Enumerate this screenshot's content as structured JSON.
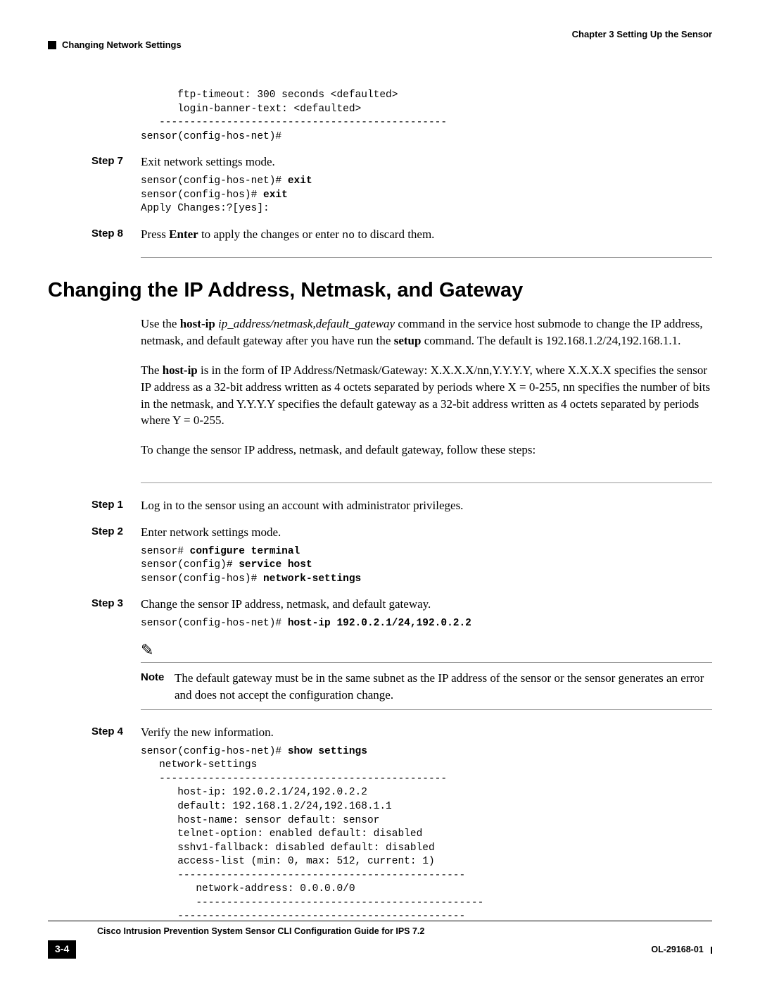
{
  "header": {
    "chapter": "Chapter 3      Setting Up the Sensor",
    "section": "Changing Network Settings"
  },
  "pre_code_top_lines": [
    "      ftp-timeout: 300 seconds <defaulted>",
    "      login-banner-text: <defaulted>",
    "   -----------------------------------------------",
    "sensor(config-hos-net)#"
  ],
  "steps_top": [
    {
      "label": "Step 7",
      "text_plain": "Exit network settings mode.",
      "code": [
        {
          "plain": "sensor(config-hos-net)# ",
          "bold": "exit"
        },
        {
          "plain": "sensor(config-hos)# ",
          "bold": "exit"
        },
        {
          "plain": "Apply Changes:?[yes]:",
          "bold": ""
        }
      ]
    },
    {
      "label": "Step 8",
      "segments": [
        {
          "t": "Press ",
          "k": "plain"
        },
        {
          "t": "Enter",
          "k": "bold"
        },
        {
          "t": " to apply the changes or enter ",
          "k": "plain"
        },
        {
          "t": "no",
          "k": "mono"
        },
        {
          "t": " to discard them.",
          "k": "plain"
        }
      ]
    }
  ],
  "section_title": "Changing the IP Address, Netmask, and Gateway",
  "paragraphs": [
    [
      {
        "t": "Use the ",
        "k": "plain"
      },
      {
        "t": "host-ip ",
        "k": "bold"
      },
      {
        "t": "ip_address/netmask,default_gateway",
        "k": "ital"
      },
      {
        "t": " command in the service host submode to change the IP address, netmask, and default gateway after you have run the ",
        "k": "plain"
      },
      {
        "t": "setup",
        "k": "bold"
      },
      {
        "t": " command. The default is 192.168.1.2/24,192.168.1.1.",
        "k": "plain"
      }
    ],
    [
      {
        "t": "The ",
        "k": "plain"
      },
      {
        "t": "host-ip",
        "k": "bold"
      },
      {
        "t": " is in the form of IP Address/Netmask/Gateway: X.X.X.X/nn,Y.Y.Y.Y, where X.X.X.X specifies the sensor IP address as a 32-bit address written as 4 octets separated by periods where X = 0-255, nn specifies the number of bits in the netmask, and Y.Y.Y.Y specifies the default gateway as a 32-bit address written as 4 octets separated by periods where Y = 0-255.",
        "k": "plain"
      }
    ],
    [
      {
        "t": "To change the sensor IP address, netmask, and default gateway, follow these steps:",
        "k": "plain"
      }
    ]
  ],
  "steps_bottom": [
    {
      "label": "Step 1",
      "segments": [
        {
          "t": "Log in to the sensor using an account with administrator privileges.",
          "k": "plain"
        }
      ]
    },
    {
      "label": "Step 2",
      "segments": [
        {
          "t": "Enter network settings mode.",
          "k": "plain"
        }
      ],
      "code": [
        {
          "plain": "sensor# ",
          "bold": "configure terminal"
        },
        {
          "plain": "sensor(config)# ",
          "bold": "service host"
        },
        {
          "plain": "sensor(config-hos)# ",
          "bold": "network-settings"
        }
      ]
    },
    {
      "label": "Step 3",
      "segments": [
        {
          "t": "Change the sensor IP address, netmask, and default gateway.",
          "k": "plain"
        }
      ],
      "code": [
        {
          "plain": "sensor(config-hos-net)# ",
          "bold": "host-ip 192.0.2.1/24,192.0.2.2"
        }
      ],
      "note": {
        "label": "Note",
        "text": "The default gateway must be in the same subnet as the IP address of the sensor or the sensor generates an error and does not accept the configuration change."
      }
    },
    {
      "label": "Step 4",
      "segments": [
        {
          "t": "Verify the new information.",
          "k": "plain"
        }
      ],
      "code": [
        {
          "plain": "sensor(config-hos-net)# ",
          "bold": "show settings"
        },
        {
          "plain": "   network-settings",
          "bold": ""
        },
        {
          "plain": "   -----------------------------------------------",
          "bold": ""
        },
        {
          "plain": "      host-ip: 192.0.2.1/24,192.0.2.2",
          "bold": ""
        },
        {
          "plain": "      default: 192.168.1.2/24,192.168.1.1",
          "bold": ""
        },
        {
          "plain": "      host-name: sensor default: sensor",
          "bold": ""
        },
        {
          "plain": "      telnet-option: enabled default: disabled",
          "bold": ""
        },
        {
          "plain": "      sshv1-fallback: disabled default: disabled",
          "bold": ""
        },
        {
          "plain": "      access-list (min: 0, max: 512, current: 1)",
          "bold": ""
        },
        {
          "plain": "      -----------------------------------------------",
          "bold": ""
        },
        {
          "plain": "         network-address: 0.0.0.0/0",
          "bold": ""
        },
        {
          "plain": "         -----------------------------------------------",
          "bold": ""
        },
        {
          "plain": "      -----------------------------------------------",
          "bold": ""
        }
      ]
    }
  ],
  "footer": {
    "title": "Cisco Intrusion Prevention System Sensor CLI Configuration Guide for IPS 7.2",
    "page": "3-4",
    "docid": "OL-29168-01"
  }
}
